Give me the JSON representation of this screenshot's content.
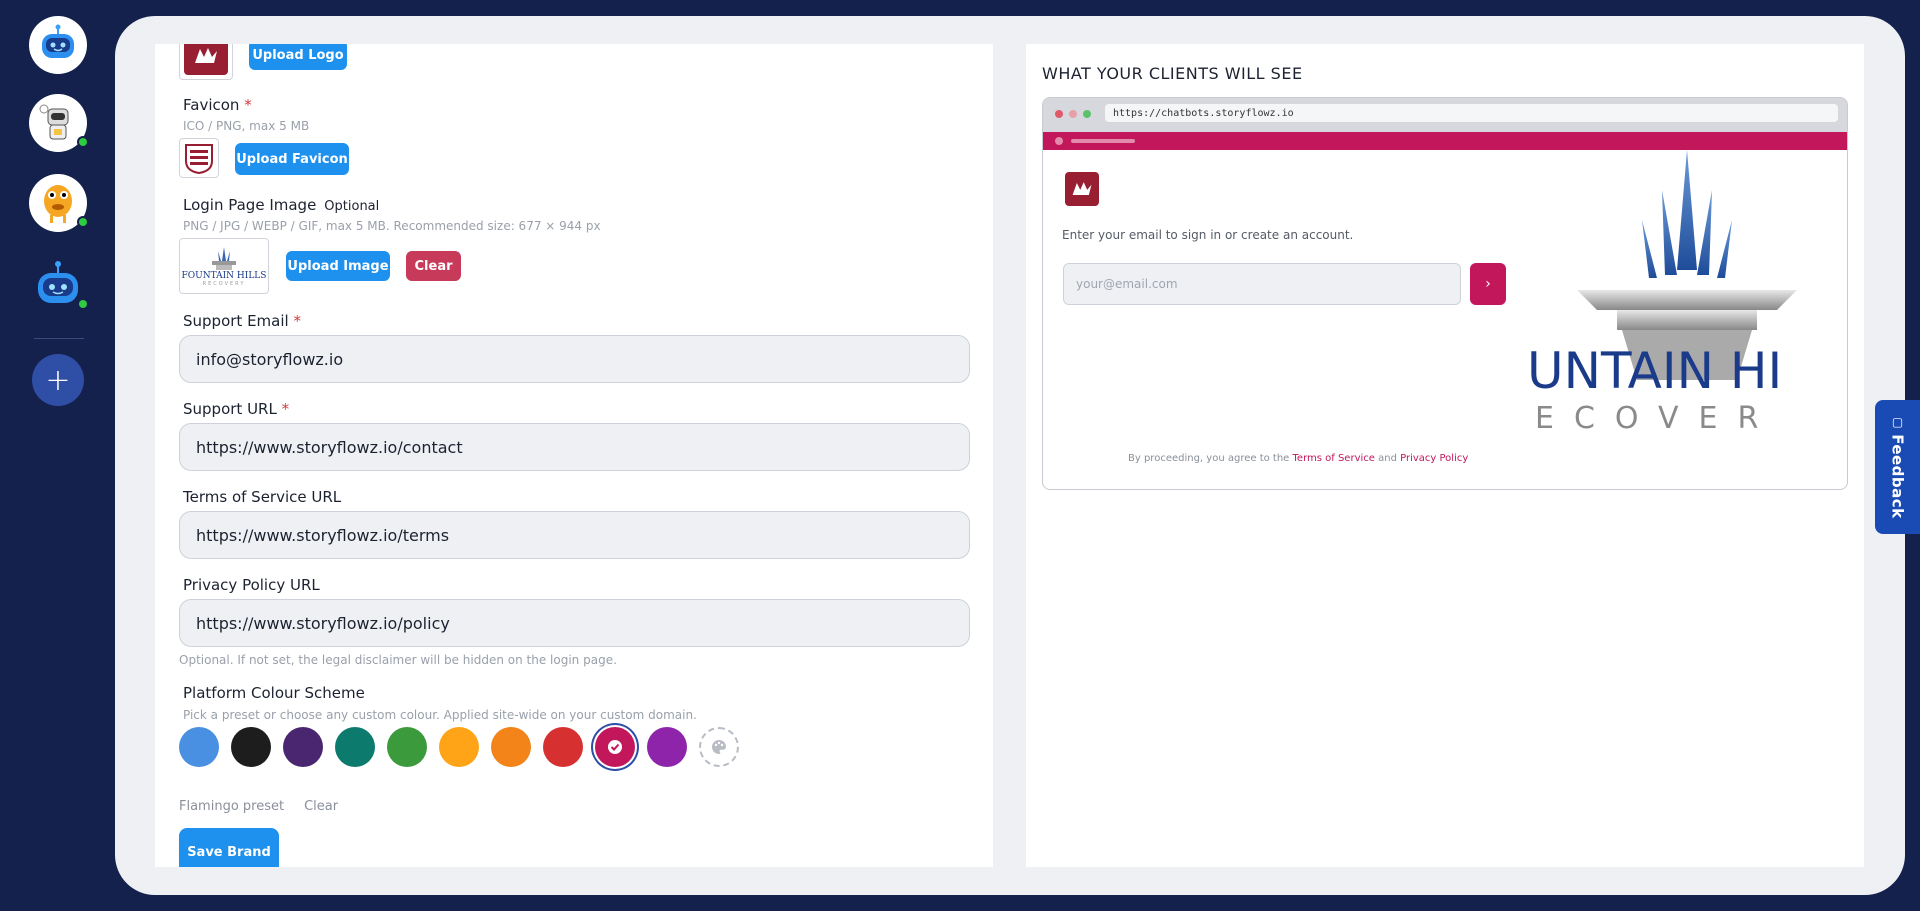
{
  "sidebar": {
    "add_label": "+"
  },
  "form": {
    "upload_logo_label": "Upload Logo",
    "favicon_label": "Favicon",
    "favicon_required": "*",
    "favicon_hint": "ICO / PNG, max 5 MB",
    "upload_favicon_label": "Upload Favicon",
    "login_image_label": "Login Page Image",
    "login_image_optional": "Optional",
    "login_image_hint": "PNG / JPG / WEBP / GIF, max 5 MB. Recommended size: 677 × 944 px",
    "upload_image_label": "Upload Image",
    "clear_image_label": "Clear",
    "support_email_label": "Support Email",
    "support_email_required": "*",
    "support_email_value": "info@storyflowz.io",
    "support_url_label": "Support URL",
    "support_url_required": "*",
    "support_url_value": "https://www.storyflowz.io/contact",
    "tos_label": "Terms of Service URL",
    "tos_value": "https://www.storyflowz.io/terms",
    "privacy_label": "Privacy Policy URL",
    "privacy_value": "https://www.storyflowz.io/policy",
    "privacy_hint": "Optional. If not set, the legal disclaimer will be hidden on the login page.",
    "color_scheme_label": "Platform Colour Scheme",
    "color_scheme_hint": "Pick a preset or choose any custom colour. Applied site-wide on your custom domain.",
    "swatches": [
      "#4a90e2",
      "#1d1d1d",
      "#4a2570",
      "#0d7a6e",
      "#3b9a3b",
      "#ffa317",
      "#f28419",
      "#d63030",
      "#c2185b",
      "#8e24aa"
    ],
    "selected_swatch_index": 8,
    "preset_name": "Flamingo preset",
    "preset_clear": "Clear",
    "save_label": "Save Brand"
  },
  "preview": {
    "title": "WHAT YOUR CLIENTS WILL SEE",
    "url": "https://chatbots.storyflowz.io",
    "sign_in_text": "Enter your email to sign in or create an account.",
    "email_placeholder": "your@email.com",
    "legal_prefix": "By proceeding, you agree to the",
    "terms_link": "Terms of Service",
    "and": "and",
    "privacy_link": "Privacy Policy",
    "image_line1": "UNTAIN HI",
    "image_line2": "ECOVER",
    "accent_color": "#c2185b"
  },
  "thumb_text": {
    "line1": "FOUNTAIN HILLS",
    "line2": "RECOVERY"
  },
  "feedback_label": "Feedback"
}
